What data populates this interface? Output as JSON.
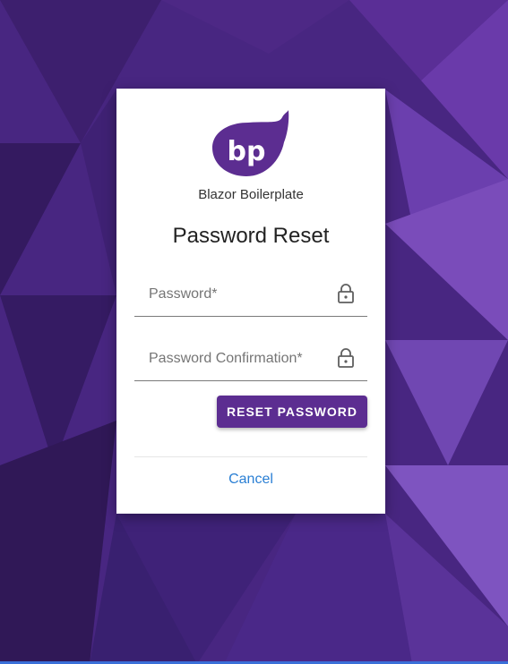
{
  "background": {
    "base_color": "#4a2580",
    "accent_color": "#6c3fb0"
  },
  "card": {
    "brand_name": "Blazor Boilerplate",
    "logo_text": "bp",
    "title": "Password Reset",
    "fields": {
      "password": {
        "placeholder": "Password*",
        "icon": "lock-icon"
      },
      "password_confirmation": {
        "placeholder": "Password Confirmation*",
        "icon": "lock-icon"
      }
    },
    "reset_button_label": "RESET PASSWORD",
    "cancel_label": "Cancel"
  },
  "colors": {
    "primary": "#5c2d91",
    "link": "#2a7fd4"
  }
}
